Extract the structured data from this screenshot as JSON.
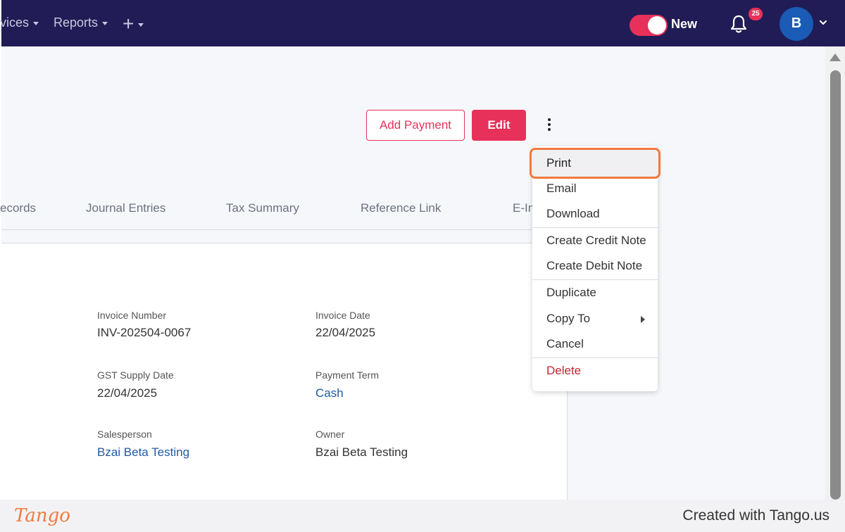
{
  "topbar": {
    "nav_services": "vices",
    "nav_reports": "Reports",
    "nav_add": "+",
    "toggle_label": "New",
    "notifications_count": "25",
    "avatar_initial": "B"
  },
  "actions": {
    "add_payment": "Add Payment",
    "edit": "Edit"
  },
  "tabs": [
    {
      "label": "ecords"
    },
    {
      "label": "Journal Entries"
    },
    {
      "label": "Tax Summary"
    },
    {
      "label": "Reference Link"
    },
    {
      "label": "E-In"
    }
  ],
  "details": {
    "invoice_number_label": "Invoice Number",
    "invoice_number": "INV-202504-0067",
    "invoice_date_label": "Invoice Date",
    "invoice_date": "22/04/2025",
    "gst_supply_date_label": "GST Supply Date",
    "gst_supply_date": "22/04/2025",
    "payment_term_label": "Payment Term",
    "payment_term": "Cash",
    "salesperson_label": "Salesperson",
    "salesperson": "Bzai Beta Testing",
    "owner_label": "Owner",
    "owner": "Bzai Beta Testing"
  },
  "menu": {
    "items": [
      {
        "label": "Print"
      },
      {
        "label": "Email"
      },
      {
        "label": "Download"
      },
      {
        "label": "Create Credit Note"
      },
      {
        "label": "Create Debit Note"
      },
      {
        "label": "Duplicate"
      },
      {
        "label": "Copy To"
      },
      {
        "label": "Cancel"
      },
      {
        "label": "Delete"
      }
    ]
  },
  "footer": {
    "logo": "Tango",
    "credit": "Created with Tango.us"
  },
  "colors": {
    "nav_bg": "#211c55",
    "accent": "#e8315a",
    "link": "#1f5aa6",
    "highlight": "#f07a3e",
    "danger": "#c0272d"
  }
}
